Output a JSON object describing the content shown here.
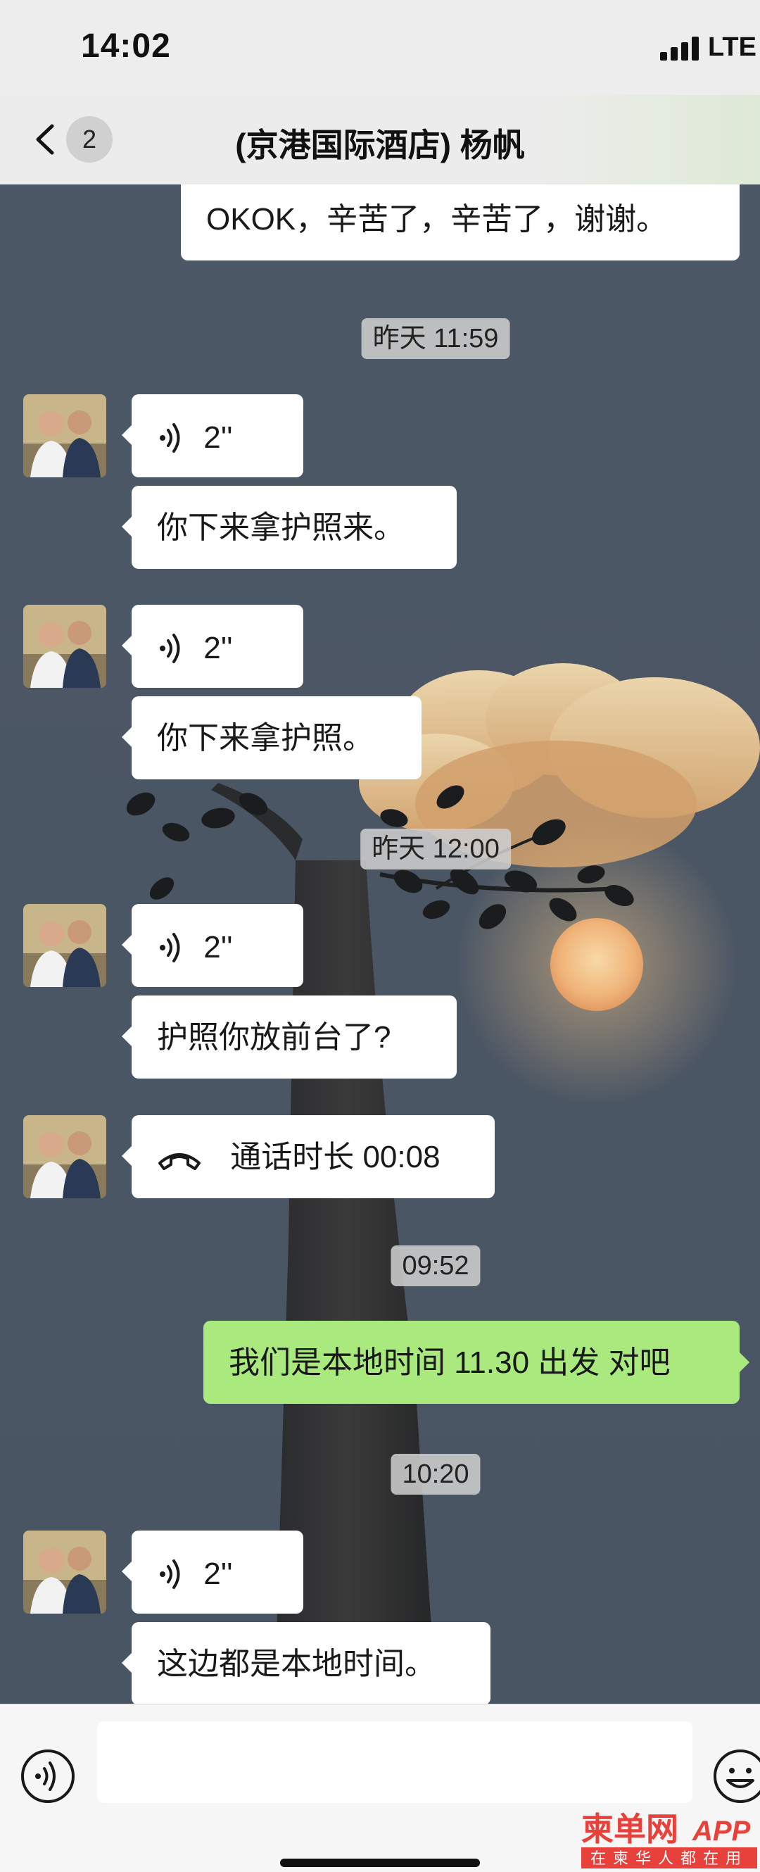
{
  "status_bar": {
    "time": "14:02",
    "network": "LTE"
  },
  "nav": {
    "unread_count": "2",
    "title": "(京港国际酒店) 杨帆"
  },
  "messages": [
    {
      "side": "right",
      "type": "text",
      "text": "OKOK，辛苦了，辛苦了，谢谢。"
    },
    {
      "type": "time",
      "text": "昨天 11:59"
    },
    {
      "side": "left",
      "type": "voice",
      "duration": "2''"
    },
    {
      "side": "left",
      "type": "text",
      "text": "你下来拿护照来。"
    },
    {
      "side": "left",
      "type": "voice",
      "duration": "2''"
    },
    {
      "side": "left",
      "type": "text",
      "text": "你下来拿护照。"
    },
    {
      "type": "time",
      "text": "昨天 12:00"
    },
    {
      "side": "left",
      "type": "voice",
      "duration": "2''"
    },
    {
      "side": "left",
      "type": "text",
      "text": "护照你放前台了?"
    },
    {
      "side": "left",
      "type": "call",
      "text": "通话时长 00:08"
    },
    {
      "type": "time",
      "text": "09:52"
    },
    {
      "side": "right",
      "type": "text",
      "text": "我们是本地时间 11.30 出发 对吧"
    },
    {
      "type": "time",
      "text": "10:20"
    },
    {
      "side": "left",
      "type": "voice",
      "duration": "2''"
    },
    {
      "side": "left",
      "type": "text",
      "text": "这边都是本地时间。"
    }
  ],
  "input": {
    "placeholder": ""
  },
  "watermark": {
    "brand": "柬单网",
    "suffix": "APP",
    "slogan": "在柬华人都在用"
  },
  "colors": {
    "sent_bubble": "#a9e97e",
    "received_bubble": "#ffffff",
    "nav_bg": "#ececec"
  }
}
